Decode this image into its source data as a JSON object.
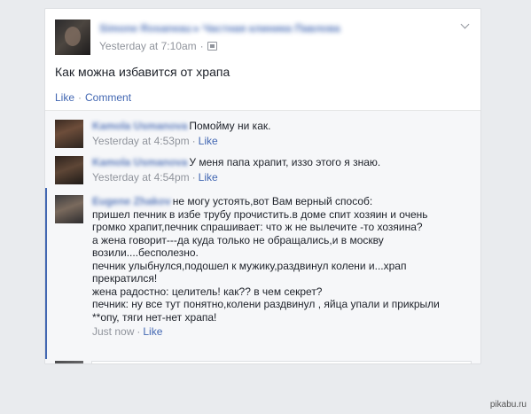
{
  "post": {
    "author": "Simone Rosaneau",
    "group": "Частная клиника Павлова",
    "timestamp": "Yesterday at 7:10am",
    "meta_separator": "·",
    "text": "Как можна избавится от храпа",
    "actions": {
      "like": "Like",
      "separator": "·",
      "comment": "Comment"
    }
  },
  "comments": [
    {
      "author": "Kamola Usmanova",
      "lines": [
        "Помойму ни как."
      ],
      "time": "Yesterday at 4:53pm",
      "separator": "·",
      "like": "Like"
    },
    {
      "author": "Kamola Usmanova",
      "lines": [
        "У меня папа храпит, иззо этого я знаю."
      ],
      "time": "Yesterday at 4:54pm",
      "separator": "·",
      "like": "Like"
    },
    {
      "author": "Eugene Zhakov",
      "lines": [
        "не могу устоять,вот Вам верный способ:",
        "пришел печник в избе трубу прочистить.в доме спит хозяин и очень",
        "громко храпит,печник спрашивает: что ж не вылечите -то хозяина?",
        "а жена говорит---да куда только не обращались,и в москву",
        "возили....бесполезно.",
        "печник улыбнулся,подошел к мужику,раздвинул колени и...храп",
        "прекратился!",
        "жена радостно: целитель! как?? в чем секрет?",
        "печник: ну все тут понятно,колени раздвинул , яйца упали и прикрыли",
        "**опу, тяги нет-нет храпа!"
      ],
      "time": "Just now",
      "separator": "·",
      "like": "Like"
    }
  ],
  "watermark": "pikabu.ru",
  "icons": {
    "privacy": "globe-icon",
    "menu": "chevron-down-icon"
  },
  "colors": {
    "link": "#4267b2",
    "meta": "#90949c",
    "background": "#e9ebee"
  }
}
